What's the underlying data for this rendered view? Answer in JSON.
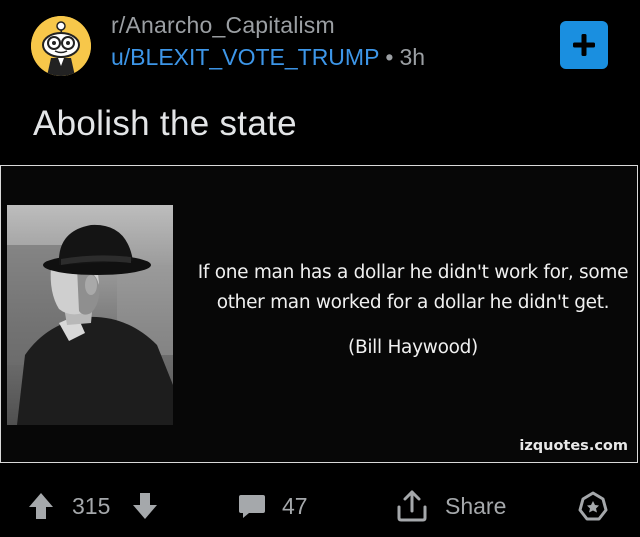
{
  "header": {
    "subreddit": "r/Anarcho_Capitalism",
    "username": "u/BLEXIT_VOTE_TRUMP",
    "separator": "•",
    "age": "3h",
    "join_icon": "plus-icon"
  },
  "post": {
    "title": "Abolish the state",
    "image": {
      "quote_line_1": "If one man has a dollar he didn't work for, some",
      "quote_line_2": "other man worked for a dollar he didn't get.",
      "author": "(Bill Haywood)",
      "watermark": "izquotes.com"
    }
  },
  "actions": {
    "vote_count": "315",
    "comment_count": "47",
    "share_label": "Share",
    "icons": [
      "upvote-icon",
      "downvote-icon",
      "comment-icon",
      "share-icon",
      "award-icon"
    ]
  },
  "colors": {
    "background": "#000000",
    "username": "#3d96e8",
    "join_button": "#1a8fe0",
    "muted_text": "#9b9fa3"
  }
}
